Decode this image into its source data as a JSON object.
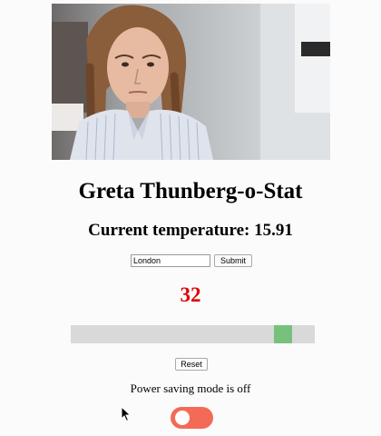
{
  "page": {
    "title": "Greta Thunberg-o-Stat"
  },
  "temperature": {
    "label": "Current temperature:",
    "value": "15.91"
  },
  "search": {
    "value": "London",
    "submit_label": "Submit"
  },
  "counter": {
    "value": "32",
    "color": "#e00000"
  },
  "slider": {
    "level": 0.9,
    "track_color": "#d9d9d9",
    "thumb_color": "#76c27c"
  },
  "reset_label": "Reset",
  "power": {
    "status_text": "Power saving mode is off",
    "enabled": false,
    "toggle_color": "#f36b56"
  },
  "icons": {
    "cursor": "mouse-pointer-icon"
  }
}
